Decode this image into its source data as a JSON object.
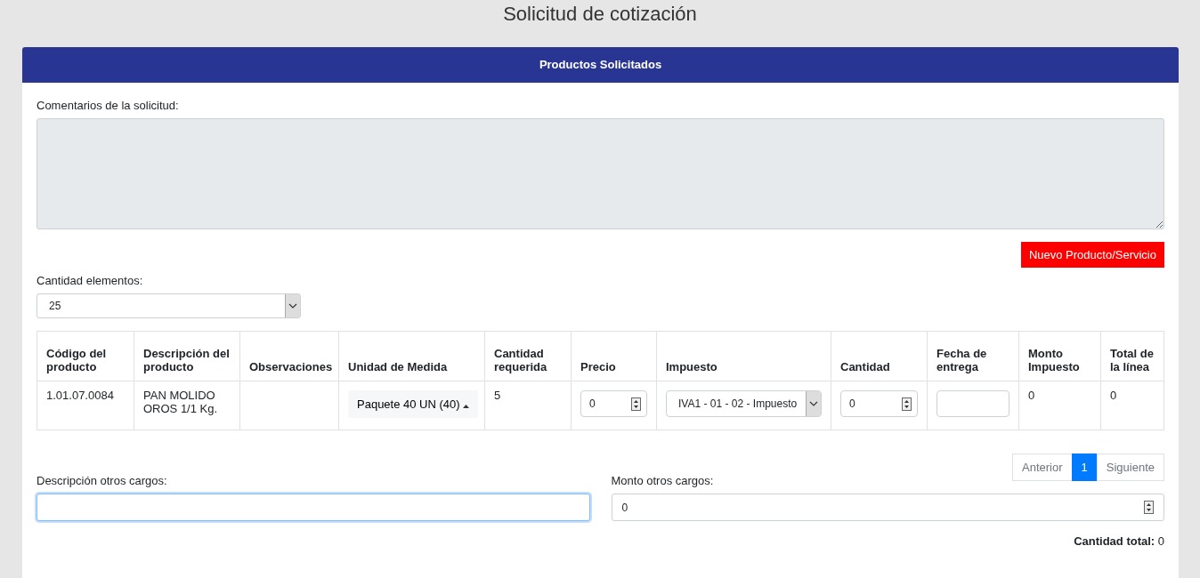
{
  "page_title": "Solicitud de cotización",
  "panel": {
    "title": "Productos Solicitados",
    "comments": {
      "label": "Comentarios de la solicitud:",
      "disabled": true
    },
    "new_button": "Nuevo Producto/Servicio",
    "page_size": {
      "label": "Cantidad elementos:",
      "value": "25"
    },
    "table": {
      "columns": [
        "Código del producto",
        "Descripción del producto",
        "Observaciones",
        "Unidad de Medida",
        "Cantidad requerida",
        "Precio",
        "Impuesto",
        "Cantidad",
        "Fecha de entrega",
        "Monto Impuesto",
        "Total de la línea"
      ],
      "rows": [
        [
          {
            "kind": "text",
            "text": "1.01.07.0084"
          },
          {
            "kind": "text",
            "text": "PAN MOLIDO OROS 1/1 Kg."
          },
          {
            "kind": "text",
            "text": ""
          },
          {
            "kind": "dropdown",
            "text": "Paquete 40 UN (40)"
          },
          {
            "kind": "text",
            "text": "5"
          },
          {
            "kind": "number",
            "text": "0"
          },
          {
            "kind": "select",
            "text": "IVA1 - 01 - 02 - Impuesto"
          },
          {
            "kind": "number",
            "text": "0"
          },
          {
            "kind": "date",
            "text": ""
          },
          {
            "kind": "text",
            "text": "0"
          },
          {
            "kind": "text",
            "text": "0"
          }
        ]
      ]
    },
    "pagination": [
      {
        "label": "Anterior",
        "selected": false
      },
      {
        "label": "1",
        "selected": true
      },
      {
        "label": "Siguiente",
        "selected": false
      }
    ],
    "other_charges": {
      "description_label": "Descripción otros cargos:",
      "description_focused": true,
      "amount_label": "Monto otros cargos:",
      "amount_value": "0"
    },
    "total": {
      "label": "Cantidad total:",
      "value": "0"
    }
  }
}
